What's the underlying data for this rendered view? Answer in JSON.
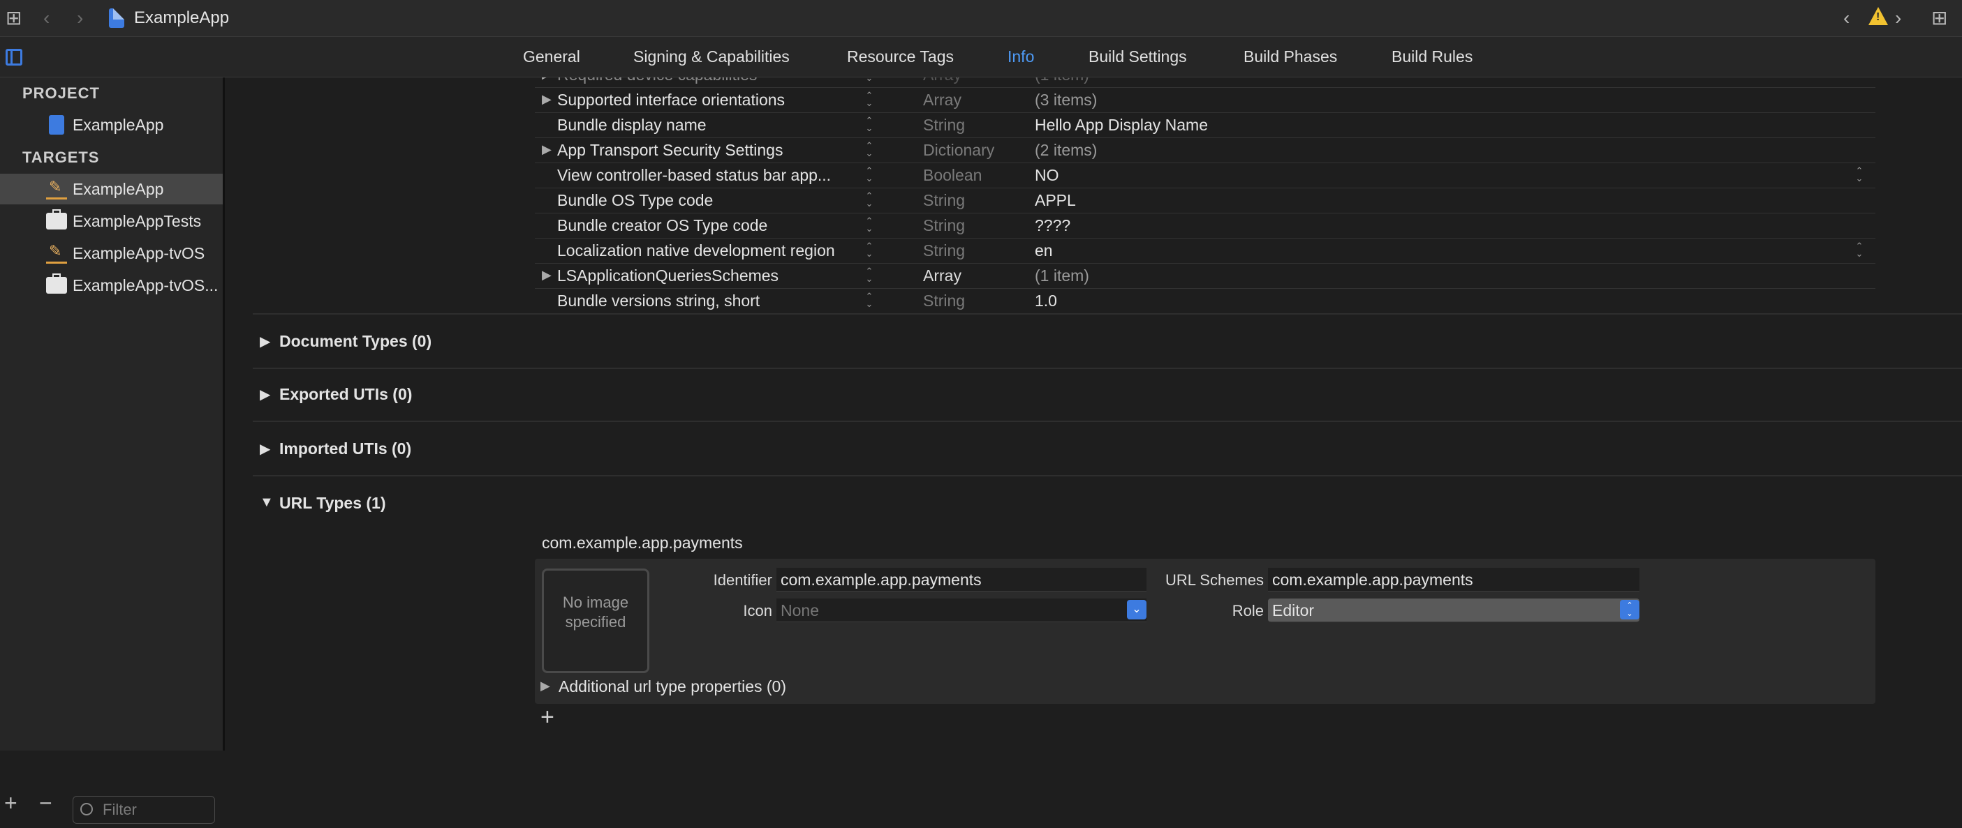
{
  "toolbar": {
    "app_title": "ExampleApp",
    "icons": [
      "grid-icon",
      "back-chevron-icon",
      "forward-chevron-icon",
      "warning-icon",
      "add-editor-icon"
    ]
  },
  "tabs": [
    {
      "label": "General"
    },
    {
      "label": "Signing & Capabilities"
    },
    {
      "label": "Resource Tags"
    },
    {
      "label": "Info",
      "active": true
    },
    {
      "label": "Build Settings"
    },
    {
      "label": "Build Phases"
    },
    {
      "label": "Build Rules"
    }
  ],
  "sidebar": {
    "project_header": "PROJECT",
    "project_item": "ExampleApp",
    "targets_header": "TARGETS",
    "targets": [
      {
        "label": "ExampleApp",
        "selected": true
      },
      {
        "label": "ExampleAppTests"
      },
      {
        "label": "ExampleApp-tvOS"
      },
      {
        "label": "ExampleApp-tvOS..."
      }
    ],
    "filter_placeholder": "Filter"
  },
  "plist_rows": [
    {
      "key": "Required device capabilities",
      "type": "Array",
      "value": "(1 item)",
      "expandable": true,
      "partial": true
    },
    {
      "key": "Supported interface orientations",
      "type": "Array",
      "value": "(3 items)",
      "expandable": true
    },
    {
      "key": "Bundle display name",
      "type": "String",
      "value": "Hello App Display Name"
    },
    {
      "key": "App Transport Security Settings",
      "type": "Dictionary",
      "value": "(2 items)",
      "expandable": true
    },
    {
      "key": "View controller-based status bar app...",
      "type": "Boolean",
      "value": "NO",
      "popup": true
    },
    {
      "key": "Bundle OS Type code",
      "type": "String",
      "value": "APPL"
    },
    {
      "key": "Bundle creator OS Type code",
      "type": "String",
      "value": "????"
    },
    {
      "key": "Localization native development region",
      "type": "String",
      "value": "en",
      "popup": true
    },
    {
      "key": "LSApplicationQueriesSchemes",
      "type": "Array",
      "value": "(1 item)",
      "expandable": true,
      "bright_type": true
    },
    {
      "key": "Bundle versions string, short",
      "type": "String",
      "value": "1.0"
    }
  ],
  "sections": [
    {
      "title": "Document Types (0)",
      "expanded": false
    },
    {
      "title": "Exported UTIs (0)",
      "expanded": false
    },
    {
      "title": "Imported UTIs (0)",
      "expanded": false
    },
    {
      "title": "URL Types (1)",
      "expanded": true
    }
  ],
  "url_type": {
    "name": "com.example.app.payments",
    "no_image": "No image specified",
    "identifier_label": "Identifier",
    "identifier_value": "com.example.app.payments",
    "icon_label": "Icon",
    "icon_placeholder": "None",
    "url_schemes_label": "URL Schemes",
    "url_schemes_value": "com.example.app.payments",
    "role_label": "Role",
    "role_value": "Editor",
    "additional_props": "Additional url type properties (0)"
  },
  "colors": {
    "accent": "#4e9bf7",
    "warning": "#f2c230",
    "background": "#1e1e1e"
  }
}
